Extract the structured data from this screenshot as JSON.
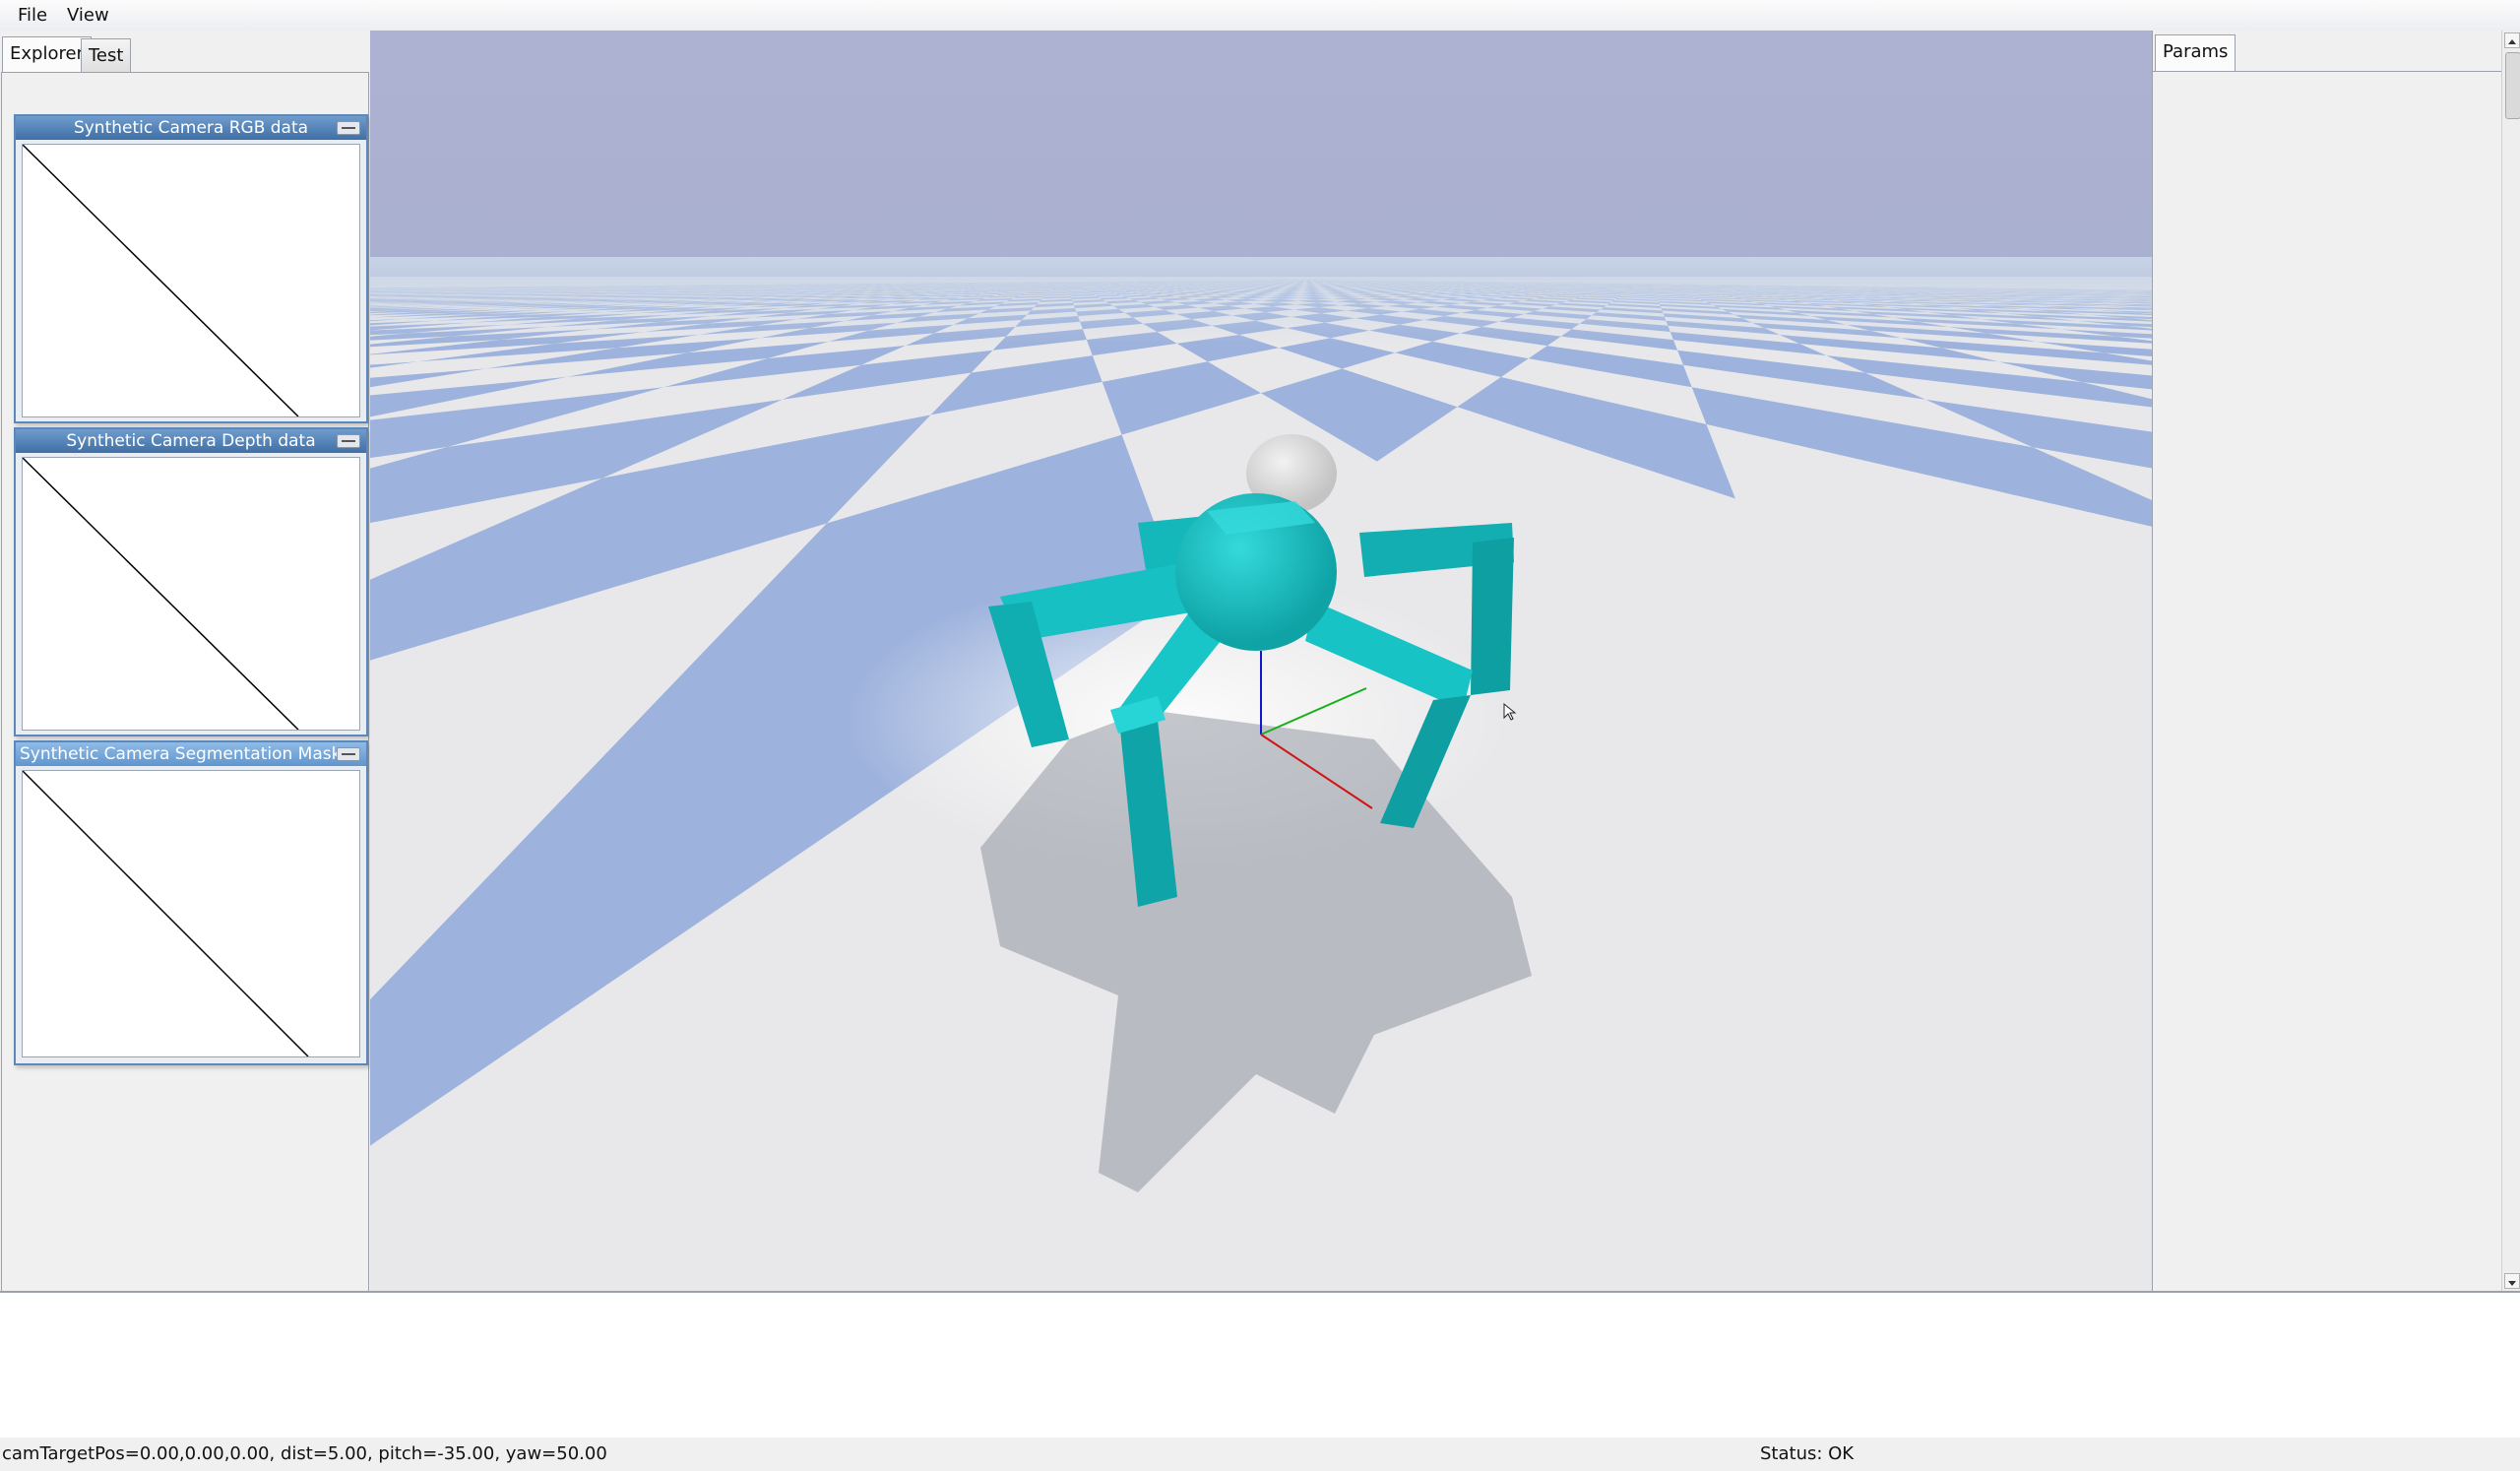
{
  "menu": [
    "File",
    "View"
  ],
  "left_tabs": [
    "Explorer",
    "Test"
  ],
  "camera_windows": [
    {
      "title": "Synthetic Camera RGB data"
    },
    {
      "title": "Synthetic Camera Depth data"
    },
    {
      "title": "Synthetic Camera Segmentation Mask"
    }
  ],
  "right_tabs": [
    "Params"
  ],
  "status": {
    "camera": "camTargetPos=0.00,0.00,0.00, dist=5.00, pitch=-35.00, yaw=50.00",
    "state": "Status: OK"
  },
  "colors": {
    "sky": "#aab0d0",
    "floor_light": "#e8e8ea",
    "floor_dark": "#9db2dc",
    "robot": "#19c4c6",
    "window_title": "#4f7fb4"
  },
  "icons": [
    "minimize-icon",
    "axis-gizmo",
    "mouse-cursor-icon",
    "scroll-up-icon",
    "scroll-down-icon"
  ]
}
